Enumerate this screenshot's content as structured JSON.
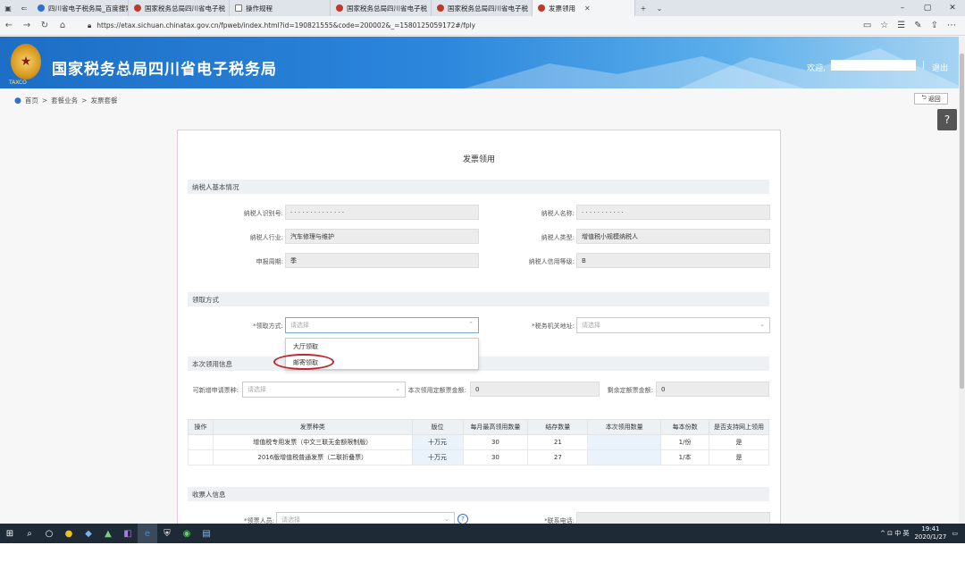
{
  "browser": {
    "tabs": [
      {
        "title": "四川省电子税务局_百度搜索",
        "icon": "paw-icon"
      },
      {
        "title": "国家税务总局四川省电子税",
        "icon": "tax-emblem-icon"
      },
      {
        "title": "操作规程",
        "icon": "page-icon"
      },
      {
        "title": "国家税务总局四川省电子税",
        "icon": "tax-emblem-icon"
      },
      {
        "title": "国家税务总局四川省电子税",
        "icon": "tax-emblem-icon"
      },
      {
        "title": "发票领用",
        "icon": "tax-emblem-icon",
        "active": true
      }
    ],
    "url": "https://etax.sichuan.chinatax.gov.cn/fpweb/index.html?id=190821555&code=200002&_=15801250591​72#/fply"
  },
  "header": {
    "title": "国家税务总局四川省电子税务局",
    "emblem_caption": "TAXCO",
    "welcome": "欢迎,",
    "separator": "|",
    "logout": "退出"
  },
  "breadcrumb": {
    "home": "首页",
    "sep1": ">",
    "item1": "套餐业务",
    "sep2": ">",
    "item2": "发票套餐"
  },
  "back_label": "返回",
  "help_glyph": "?",
  "form": {
    "title": "发票领用",
    "section_basic": "纳税人基本情况",
    "taxpayer_id_label": "纳税人识别号:",
    "taxpayer_id": "· · · · · · · · · · · · · ·",
    "taxpayer_name_label": "纳税人名称:",
    "taxpayer_name": "· · · · · · · · · · ·",
    "industry_label": "纳税人行业:",
    "industry": "汽车修理与维护",
    "type_label": "纳税人类型:",
    "type": "增值税小规模纳税人",
    "period_label": "申报周期:",
    "period": "季",
    "credit_label": "纳税人信用等级:",
    "credit": "B",
    "section_method": "领取方式",
    "method_label": "*领取方式:",
    "method_placeholder": "请选择",
    "address_label": "*税务机关地址:",
    "address_placeholder": "请选择",
    "method_options": [
      "大厅领取",
      "邮寄领取"
    ],
    "section_current": "本次领用信息",
    "invoice_type_label": "可新增申请票种:",
    "invoice_type_placeholder": "请选择",
    "amount_label": "本次领用定额票金额:",
    "amount": "0",
    "remain_label": "剩余定额票金额:",
    "remain": "0",
    "section_receiver": "收票人信息",
    "receiver_label": "*领票人员:",
    "receiver_placeholder": "请选择",
    "phone_label": "*联系电话:"
  },
  "table": {
    "headers": [
      "操作",
      "发票种类",
      "版位",
      "每月最高领用数量",
      "结存数量",
      "本次领用数量",
      "每本份数",
      "是否支持网上领用"
    ],
    "rows": [
      [
        "",
        "增值税专用发票（中文三联无金额限制版）",
        "十万元",
        "30",
        "21",
        "",
        "1/份",
        "是"
      ],
      [
        "",
        "2016版增值税普通发票（二联折叠票）",
        "十万元",
        "30",
        "27",
        "",
        "1/本",
        "是"
      ]
    ]
  },
  "taskbar": {
    "tray": "^  ⊡  中  英",
    "time": "19:41",
    "date": "2020/1/27"
  },
  "colors": {
    "header_blue": "#1d6ec5",
    "highlight_red": "#c0262d",
    "section_bg": "#eef1f4"
  }
}
